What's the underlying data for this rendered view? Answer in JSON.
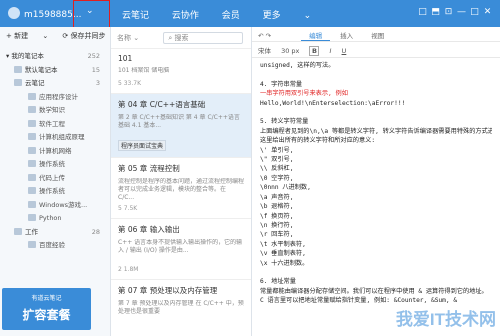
{
  "topbar": {
    "user": "m1598885...",
    "user_caret": "⌄",
    "nav": [
      "云笔记",
      "云协作",
      "会员",
      "更多"
    ],
    "more_caret": "⌄",
    "icons": [
      "□",
      "⬒",
      "⊡",
      "—",
      "□",
      "✕"
    ]
  },
  "sidebar": {
    "new_label": "新建",
    "sync_label": "保存并同步",
    "tree": [
      {
        "label": "我的笔记本",
        "count": "252"
      },
      {
        "label": "默认笔记本",
        "count": "15"
      },
      {
        "label": "云笔记",
        "count": "3"
      },
      {
        "label": "应用程序设计",
        "count": ""
      },
      {
        "label": "数学知识",
        "count": ""
      },
      {
        "label": "软件工程",
        "count": ""
      },
      {
        "label": "计算机组成原理",
        "count": ""
      },
      {
        "label": "计算机网络",
        "count": ""
      },
      {
        "label": "操作系统",
        "count": ""
      },
      {
        "label": "代码上传",
        "count": ""
      },
      {
        "label": "操作系统",
        "count": ""
      },
      {
        "label": "Windows游戏...",
        "count": ""
      },
      {
        "label": "Python",
        "count": ""
      },
      {
        "label": "工作",
        "count": "28"
      },
      {
        "label": "百度经验",
        "count": ""
      }
    ],
    "promo_sub": "有道云笔记",
    "promo_title": "扩容套餐"
  },
  "notelist": {
    "header": "名称 ⌄",
    "search_placeholder": "搜索",
    "notes": [
      {
        "title": "101",
        "snippet": "101   档案馆 储电脑",
        "meta": "5   33.7K"
      },
      {
        "title": "第 04 章 C/C++语言基础",
        "snippet": "第 2 章 C/C++基础知识 第 4 章 C/C++语言基础 4.1 基本...",
        "meta": "程序员面试宝典"
      },
      {
        "title": "第 05 章 流程控制",
        "snippet": "流程控制是程序的基本问题，通过流程控制编程者可以完成业务逻辑，模块的整合等。在 C/C...",
        "meta": "5   7.5K"
      },
      {
        "title": "第 06 章 输入输出",
        "snippet": "C++ 语言本身不提供输入输出操作的，它的输入 / 输出 (I/O) 操作是由...",
        "meta": "2   1.8M"
      },
      {
        "title": "第 07 章 预处理以及内存管理",
        "snippet": "第 7 章 预处理以及内存管理 在 C/C++ 中，预处理也是很重要",
        "meta": ""
      }
    ]
  },
  "editor": {
    "tabs": [
      "编辑",
      "插入",
      "视图"
    ],
    "font": "宋体",
    "size": "30 px",
    "bold": "B",
    "italic": "I",
    "underline": "U",
    "lines": [
      {
        "text": "unsigned, 这样的写法。",
        "red": false
      },
      {
        "text": "",
        "red": false
      },
      {
        "text": "4.  字符串常量",
        "red": false
      },
      {
        "text": "一串字符用双引号来表示, 例如",
        "red": true
      },
      {
        "text": "Hello,World!\\nEnterselection:\\aError!!!",
        "red": false
      },
      {
        "text": "",
        "red": false
      },
      {
        "text": "5.  转义字符常量",
        "red": false
      },
      {
        "text": "上面编程者见到的\\n,\\a 等都是转义字符, 转义字符告诉编译器需要用特殊的方式进行处理。",
        "red": false
      },
      {
        "text": "这里给出所有的转义字符和所对应的意义:",
        "red": false
      },
      {
        "text": "\\' 单引号,",
        "red": false
      },
      {
        "text": "\\\" 双引号,",
        "red": false
      },
      {
        "text": "\\\\ 反斜杠,",
        "red": false
      },
      {
        "text": "\\0 空字符,",
        "red": false
      },
      {
        "text": "\\0nnn 八进制数,",
        "red": false
      },
      {
        "text": "\\a 声音符,",
        "red": false
      },
      {
        "text": "\\b 退格符,",
        "red": false
      },
      {
        "text": "\\f 换页符,",
        "red": false
      },
      {
        "text": "\\n 换行符,",
        "red": false
      },
      {
        "text": "\\r 回车符,",
        "red": false
      },
      {
        "text": "\\t 水平制表符,",
        "red": false
      },
      {
        "text": "\\v 垂直制表符,",
        "red": false
      },
      {
        "text": "\\x 十六进制数。",
        "red": false
      },
      {
        "text": "",
        "red": false
      },
      {
        "text": "6.  地址常量",
        "red": false
      },
      {
        "text": "常量都能由编译器分配存储空间。我们可以在程序中使用 & 运算符得到它的地址。",
        "red": false
      },
      {
        "text": "C 语言里可以把地址常量赋给指针变量, 例如: &Counter, &Sum, &",
        "red": false
      }
    ],
    "watermark": "我爱IT技术网"
  }
}
